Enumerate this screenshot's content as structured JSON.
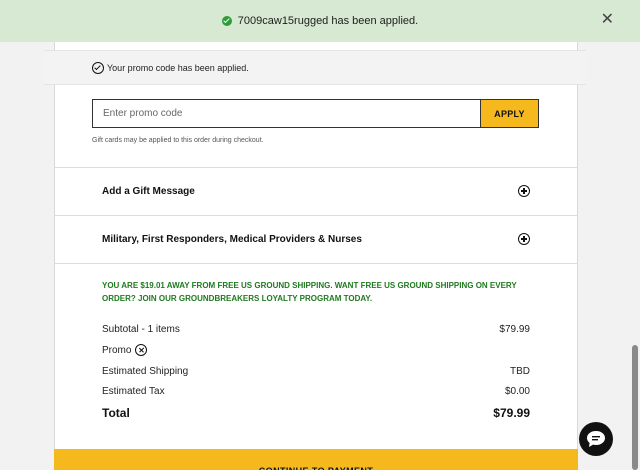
{
  "toast": {
    "message": "7009caw15rugged has been applied.",
    "close_symbol": "✕"
  },
  "promo": {
    "applied_text": "Your promo code has been applied.",
    "input_placeholder": "Enter promo code",
    "apply_label": "APPLY",
    "gift_note": "Gift cards may be applied to this order during checkout."
  },
  "accordions": [
    {
      "label": "Add a Gift Message",
      "icon": "plus-circle-icon"
    },
    {
      "label": "Military, First Responders, Medical Providers & Nurses",
      "icon": "plus-circle-icon"
    }
  ],
  "shipping_message": "YOU ARE $19.01 AWAY FROM FREE US GROUND SHIPPING. WANT FREE US GROUND SHIPPING ON EVERY ORDER? JOIN OUR GROUNDBREAKERS LOYALTY PROGRAM TODAY.",
  "summary": {
    "subtotal_label": "Subtotal - 1 items",
    "subtotal_value": "$79.99",
    "promo_label": "Promo",
    "shipping_label": "Estimated Shipping",
    "shipping_value": "TBD",
    "tax_label": "Estimated Tax",
    "tax_value": "$0.00",
    "total_label": "Total",
    "total_value": "$79.99"
  },
  "continue_label": "CONTINUE TO PAYMENT",
  "colors": {
    "accent": "#f5b91e",
    "success_green": "#1f7a1f",
    "toast_bg": "#d7e9d2"
  }
}
